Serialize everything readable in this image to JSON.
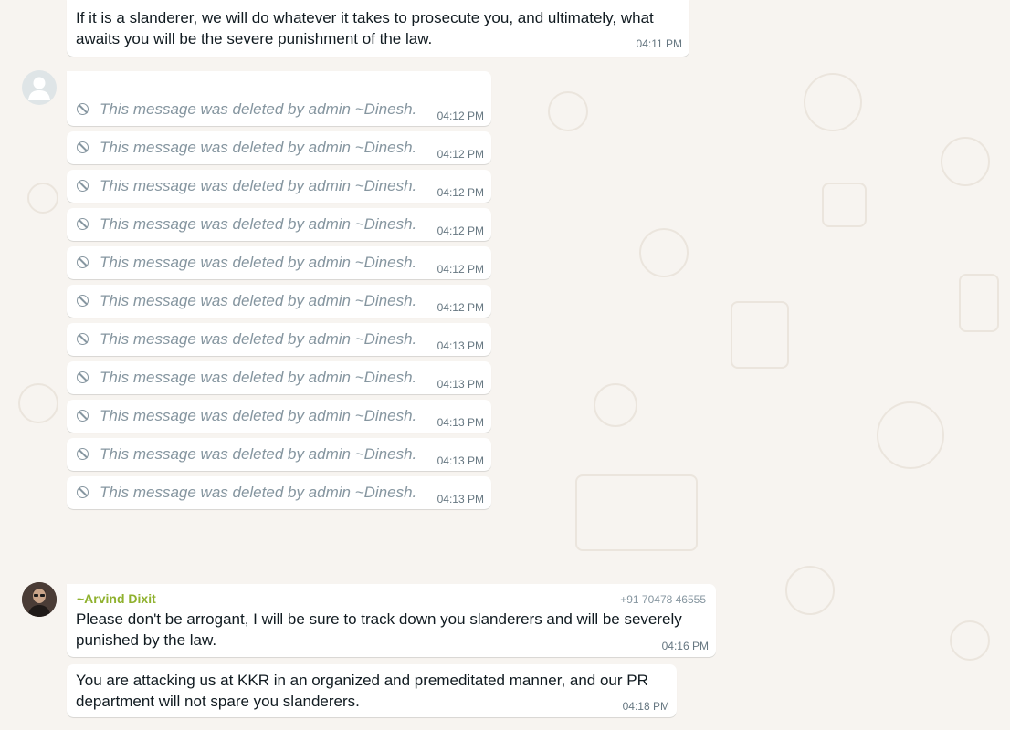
{
  "colors": {
    "wallpaper": "#f7f4f0",
    "bubble": "#ffffff",
    "text": "#111b21",
    "meta": "#667781",
    "deleted_text": "#8696a0",
    "sender_name": "#8fb12e"
  },
  "icons": {
    "deleted": "prohibited-circle-icon",
    "default_avatar": "default-user-icon"
  },
  "messages": {
    "top": {
      "text": "If it is a slanderer, we will do whatever it takes to prosecute you, and ultimately, what awaits you will be the severe punishment of the law.",
      "time": "04:11 PM"
    },
    "deleted": [
      {
        "text": "This message was deleted by admin ~Dinesh.",
        "time": "04:12 PM"
      },
      {
        "text": "This message was deleted by admin ~Dinesh.",
        "time": "04:12 PM"
      },
      {
        "text": "This message was deleted by admin ~Dinesh.",
        "time": "04:12 PM"
      },
      {
        "text": "This message was deleted by admin ~Dinesh.",
        "time": "04:12 PM"
      },
      {
        "text": "This message was deleted by admin ~Dinesh.",
        "time": "04:12 PM"
      },
      {
        "text": "This message was deleted by admin ~Dinesh.",
        "time": "04:12 PM"
      },
      {
        "text": "This message was deleted by admin ~Dinesh.",
        "time": "04:13 PM"
      },
      {
        "text": "This message was deleted by admin ~Dinesh.",
        "time": "04:13 PM"
      },
      {
        "text": "This message was deleted by admin ~Dinesh.",
        "time": "04:13 PM"
      },
      {
        "text": "This message was deleted by admin ~Dinesh.",
        "time": "04:13 PM"
      },
      {
        "text": "This message was deleted by admin ~Dinesh.",
        "time": "04:13 PM"
      }
    ],
    "arvind": {
      "sender": "~Arvind Dixit",
      "phone": "+91 70478 46555",
      "text": "Please don't be arrogant, I will be sure to track down you slanderers and will be severely punished by the law.",
      "time": "04:16 PM"
    },
    "arvind_followup": {
      "text": "You are attacking us at KKR in an organized and premeditated manner, and our PR department will not spare you slanderers.",
      "time": "04:18 PM"
    }
  }
}
